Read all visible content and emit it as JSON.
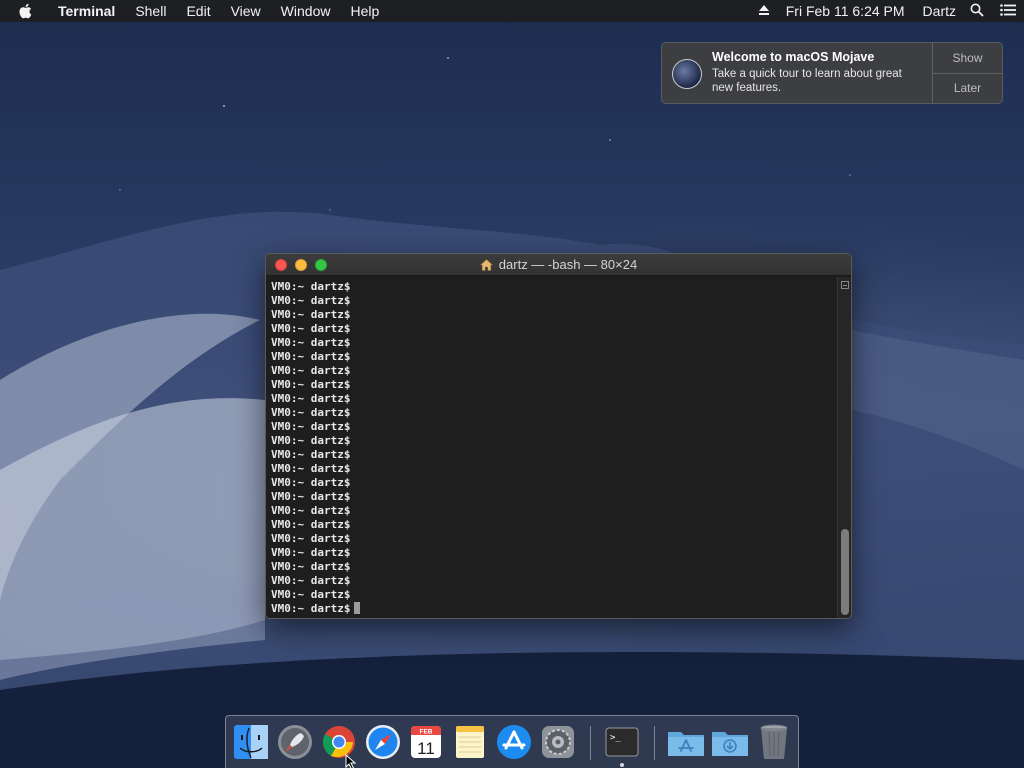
{
  "menubar": {
    "app_name": "Terminal",
    "menus": [
      "Shell",
      "Edit",
      "View",
      "Window",
      "Help"
    ],
    "clock": "Fri Feb 11  6:24 PM",
    "user": "Dartz",
    "icons": [
      "apple-icon",
      "eject-icon",
      "spotlight-search-icon",
      "notification-center-icon"
    ]
  },
  "notification": {
    "title": "Welcome to macOS Mojave",
    "text": "Take a quick tour to learn about great new features.",
    "show_label": "Show",
    "later_label": "Later"
  },
  "terminal": {
    "title": "dartz — -bash — 80×24",
    "lines": [
      "VM0:~ dartz$",
      "VM0:~ dartz$",
      "VM0:~ dartz$",
      "VM0:~ dartz$",
      "VM0:~ dartz$",
      "VM0:~ dartz$",
      "VM0:~ dartz$",
      "VM0:~ dartz$",
      "VM0:~ dartz$",
      "VM0:~ dartz$",
      "VM0:~ dartz$",
      "VM0:~ dartz$",
      "VM0:~ dartz$",
      "VM0:~ dartz$",
      "VM0:~ dartz$",
      "VM0:~ dartz$",
      "VM0:~ dartz$",
      "VM0:~ dartz$",
      "VM0:~ dartz$",
      "VM0:~ dartz$",
      "VM0:~ dartz$",
      "VM0:~ dartz$",
      "VM0:~ dartz$",
      "VM0:~ dartz$"
    ],
    "colors": {
      "background": "#1e1e1e",
      "text": "#e8e8e8",
      "close": "#fc5753",
      "minimize": "#fdbc40",
      "zoom": "#33c748"
    }
  },
  "dock": {
    "items": [
      {
        "icon": "finder-icon"
      },
      {
        "icon": "launchpad-icon"
      },
      {
        "icon": "chrome-icon"
      },
      {
        "icon": "safari-icon"
      },
      {
        "icon": "calendar-icon",
        "month": "FEB",
        "day": "11"
      },
      {
        "icon": "notes-icon"
      },
      {
        "icon": "app-store-icon"
      },
      {
        "icon": "system-preferences-icon"
      },
      {
        "icon": "terminal-icon",
        "glyph": ">_"
      },
      {
        "icon": "applications-folder-icon"
      },
      {
        "icon": "downloads-folder-icon"
      },
      {
        "icon": "trash-icon"
      }
    ]
  }
}
